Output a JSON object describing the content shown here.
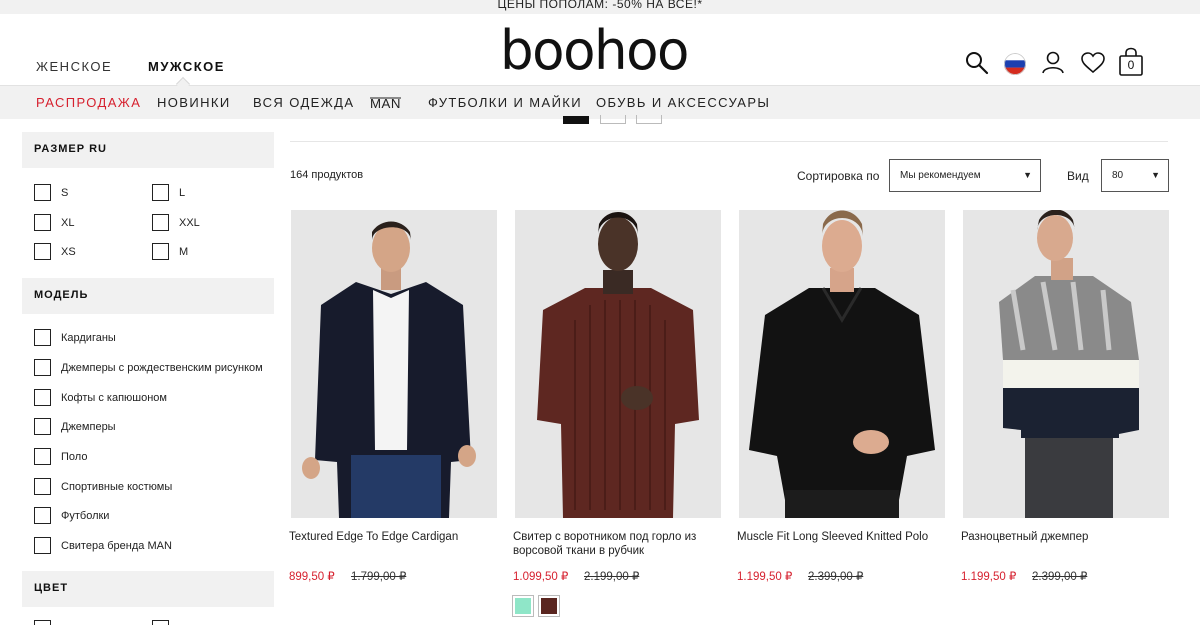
{
  "promo": {
    "text": "ЦЕНЫ ПОПОЛАМ: -50% НА ВСЁ!*"
  },
  "header": {
    "women": "ЖЕНСКОЕ",
    "men": "МУЖСКОЕ",
    "logo": "boohoo",
    "bag_count": "0",
    "icons": [
      "search-icon",
      "russia-flag-icon",
      "user-icon",
      "heart-icon",
      "bag-icon"
    ]
  },
  "nav": {
    "items": [
      "РАСПРОДАЖА",
      "НОВИНКИ",
      "ВСЯ ОДЕЖДА",
      "MAN",
      "ФУТБОЛКИ И МАЙКИ",
      "ОБУВЬ И АКСЕССУАРЫ"
    ]
  },
  "filters": {
    "size": {
      "title": "РАЗМЕР RU",
      "options": [
        "S",
        "L",
        "XL",
        "XXL",
        "XS",
        "M"
      ]
    },
    "model": {
      "title": "МОДЕЛЬ",
      "options": [
        "Кардиганы",
        "Джемперы с рождественским рисунком",
        "Кофты с капюшоном",
        "Джемперы",
        "Поло",
        "Спортивные костюмы",
        "Футболки",
        "Свитера бренда MAN"
      ]
    },
    "color": {
      "title": "ЦВЕТ"
    }
  },
  "toolbar": {
    "count": "164 продуктов",
    "sort_label": "Сортировка по",
    "sort_value": "Мы рекомендуем",
    "view_label": "Вид",
    "view_value": "80"
  },
  "products": [
    {
      "name": "Textured Edge To Edge Cardigan",
      "price": "899,50 ₽",
      "old_price": "1.799,00 ₽"
    },
    {
      "name": "Свитер с воротником под горло из ворсовой ткани в рубчик",
      "price": "1.099,50 ₽",
      "old_price": "2.199,00 ₽",
      "swatches": [
        "#8fe6c8",
        "#5a2620"
      ]
    },
    {
      "name": "Muscle Fit Long Sleeved Knitted Polo",
      "price": "1.199,50 ₽",
      "old_price": "2.399,00 ₽"
    },
    {
      "name": "Разноцветный джемпер",
      "price": "1.199,50 ₽",
      "old_price": "2.399,00 ₽"
    }
  ],
  "colors": {
    "sale": "#d6212f",
    "band": "#f1f1f1"
  }
}
